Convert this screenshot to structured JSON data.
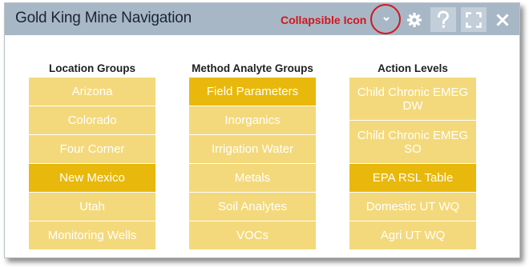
{
  "window": {
    "title": "Gold King Mine Navigation"
  },
  "annotation": {
    "label": "Collapsible Icon"
  },
  "toolbar": {
    "collapse_icon": "chevron-down-icon",
    "settings_icon": "gear-icon",
    "help_icon": "question-mark-icon",
    "fullscreen_icon": "fullscreen-icon",
    "close_icon": "close-icon"
  },
  "colors": {
    "titlebar": "#a7b7c6",
    "tile": "#f3d97b",
    "tile_selected": "#e8b90c",
    "annotation": "#d4161c"
  },
  "columns": [
    {
      "header": "Location Groups",
      "items": [
        {
          "label": "Arizona",
          "selected": false
        },
        {
          "label": "Colorado",
          "selected": false
        },
        {
          "label": "Four Corner",
          "selected": false
        },
        {
          "label": "New Mexico",
          "selected": true
        },
        {
          "label": "Utah",
          "selected": false
        },
        {
          "label": "Monitoring Wells",
          "selected": false
        }
      ]
    },
    {
      "header": "Method Analyte Groups",
      "items": [
        {
          "label": "Field Parameters",
          "selected": true
        },
        {
          "label": "Inorganics",
          "selected": false
        },
        {
          "label": "Irrigation Water",
          "selected": false
        },
        {
          "label": "Metals",
          "selected": false
        },
        {
          "label": "Soil Analytes",
          "selected": false
        },
        {
          "label": "VOCs",
          "selected": false
        }
      ]
    },
    {
      "header": "Action Levels",
      "items": [
        {
          "label": "Child Chronic EMEG DW",
          "selected": false
        },
        {
          "label": "Child Chronic EMEG SO",
          "selected": false
        },
        {
          "label": "EPA RSL Table",
          "selected": true
        },
        {
          "label": "Domestic UT WQ",
          "selected": false
        },
        {
          "label": "Agri UT WQ",
          "selected": false
        }
      ]
    }
  ]
}
